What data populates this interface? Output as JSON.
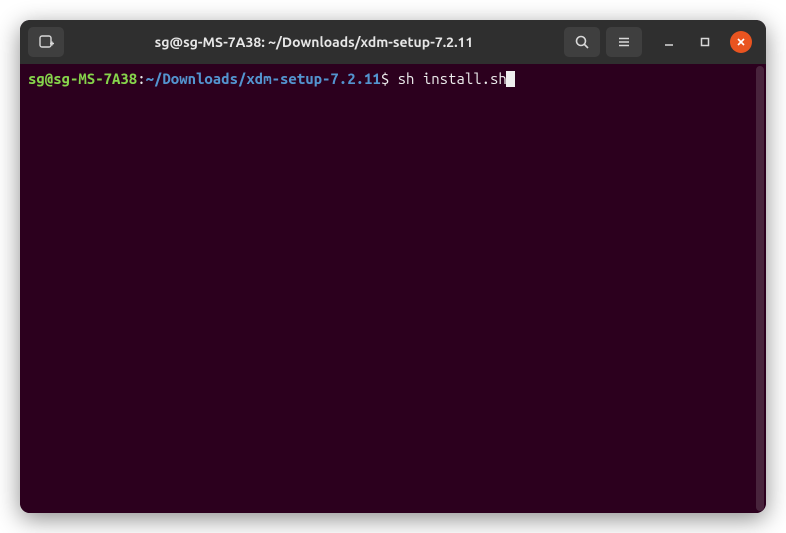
{
  "window": {
    "title": "sg@sg-MS-7A38: ~/Downloads/xdm-setup-7.2.11"
  },
  "titlebar": {
    "new_tab_icon": "new-tab-icon",
    "search_icon": "search-icon",
    "menu_icon": "hamburger-icon",
    "minimize_icon": "minimize-icon",
    "maximize_icon": "maximize-icon",
    "close_icon": "close-icon"
  },
  "terminal": {
    "prompt": {
      "user_host": "sg@sg-MS-7A38",
      "colon": ":",
      "path": "~/Downloads/xdm-setup-7.2.11",
      "dollar": "$ "
    },
    "command": "sh install.sh"
  },
  "colors": {
    "titlebar_bg": "#2f2f2f",
    "terminal_bg": "#2c001e",
    "prompt_green": "#86d44b",
    "prompt_blue": "#5394cf",
    "close_orange": "#e95420"
  }
}
